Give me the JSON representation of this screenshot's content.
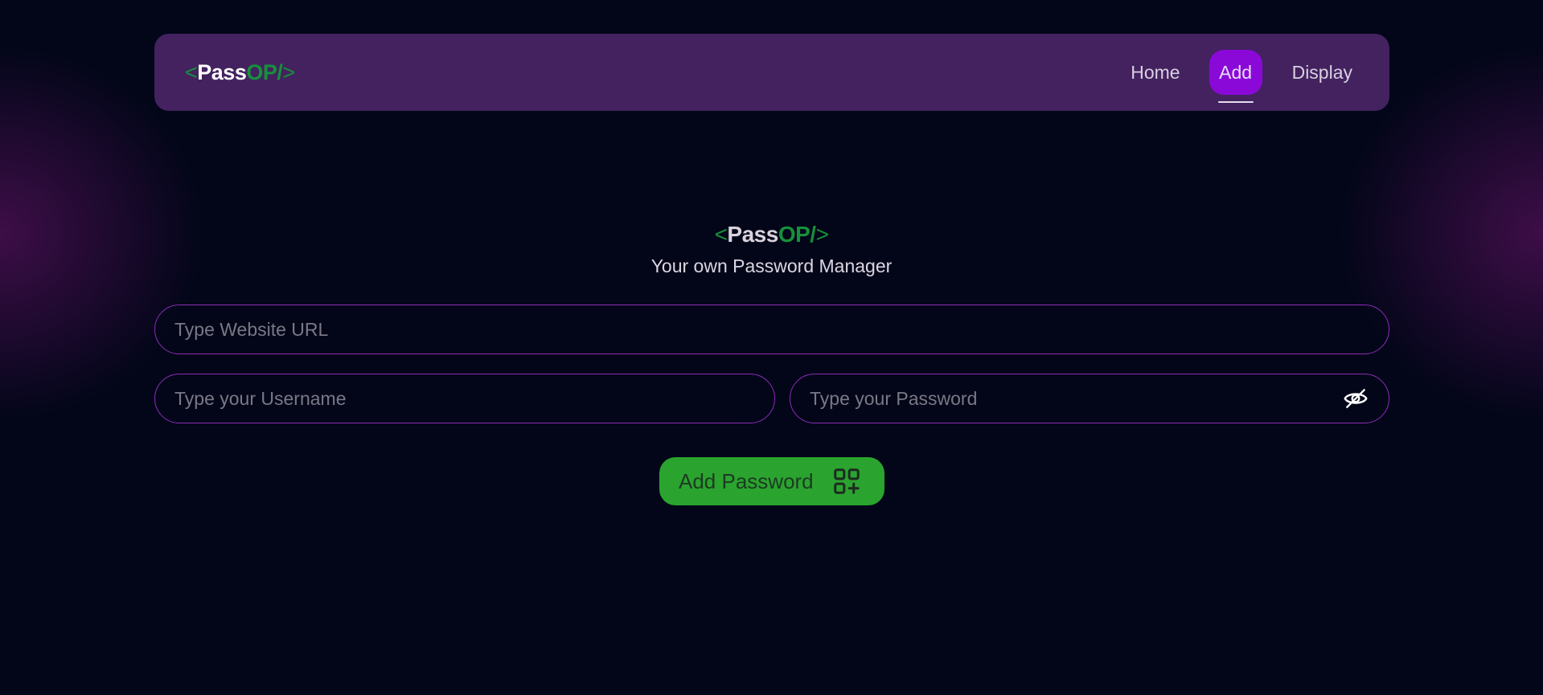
{
  "nav": {
    "logo": {
      "open": "<",
      "pass": "Pass",
      "op": "OP/",
      "close": ">"
    },
    "links": [
      {
        "label": "Home"
      },
      {
        "label": "Add"
      },
      {
        "label": "Display"
      }
    ],
    "active": "Add"
  },
  "hero": {
    "logo": {
      "open": "<",
      "pass": "Pass",
      "op": "OP/",
      "close": ">"
    },
    "tagline": "Your own Password Manager"
  },
  "form": {
    "website": {
      "value": "",
      "placeholder": "Type Website URL"
    },
    "username": {
      "value": "",
      "placeholder": "Type your Username"
    },
    "password": {
      "value": "",
      "placeholder": "Type your Password"
    },
    "submit_label": "Add Password"
  },
  "icons": {
    "visibility_toggle": "eye-slash-icon",
    "add_button": "grid-plus-icon"
  },
  "colors": {
    "background": "#030619",
    "navbar": "#43225f",
    "accent_purple": "#8a09d8",
    "brand_green": "#15913a",
    "button_green": "#2aa42e",
    "input_border": "#8c2cb8"
  }
}
